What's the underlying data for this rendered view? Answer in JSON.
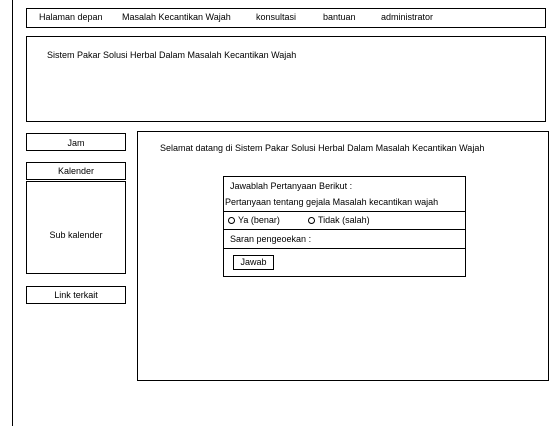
{
  "nav": {
    "items": [
      "Halaman depan",
      "Masalah Kecantikan Wajah",
      "konsultasi",
      "bantuan",
      "administrator"
    ]
  },
  "header": {
    "title": "Sistem Pakar Solusi Herbal Dalam Masalah Kecantikan Wajah"
  },
  "sidebar": {
    "clock": "Jam",
    "calendar": "Kalender",
    "sub_calendar": "Sub kalender",
    "related_links": "Link terkait"
  },
  "main": {
    "welcome": "Selamat datang di Sistem Pakar Solusi Herbal Dalam Masalah Kecantikan Wajah",
    "form": {
      "heading": "Jawablah Pertanyaan Berikut :",
      "question": "Pertanyaan tentang gejala Masalah kecantikan wajah",
      "option_yes": "Ya (benar)",
      "option_no": "Tidak (salah)",
      "suggestion_label": "Saran pengeoekan :",
      "submit_label": "Jawab"
    }
  }
}
